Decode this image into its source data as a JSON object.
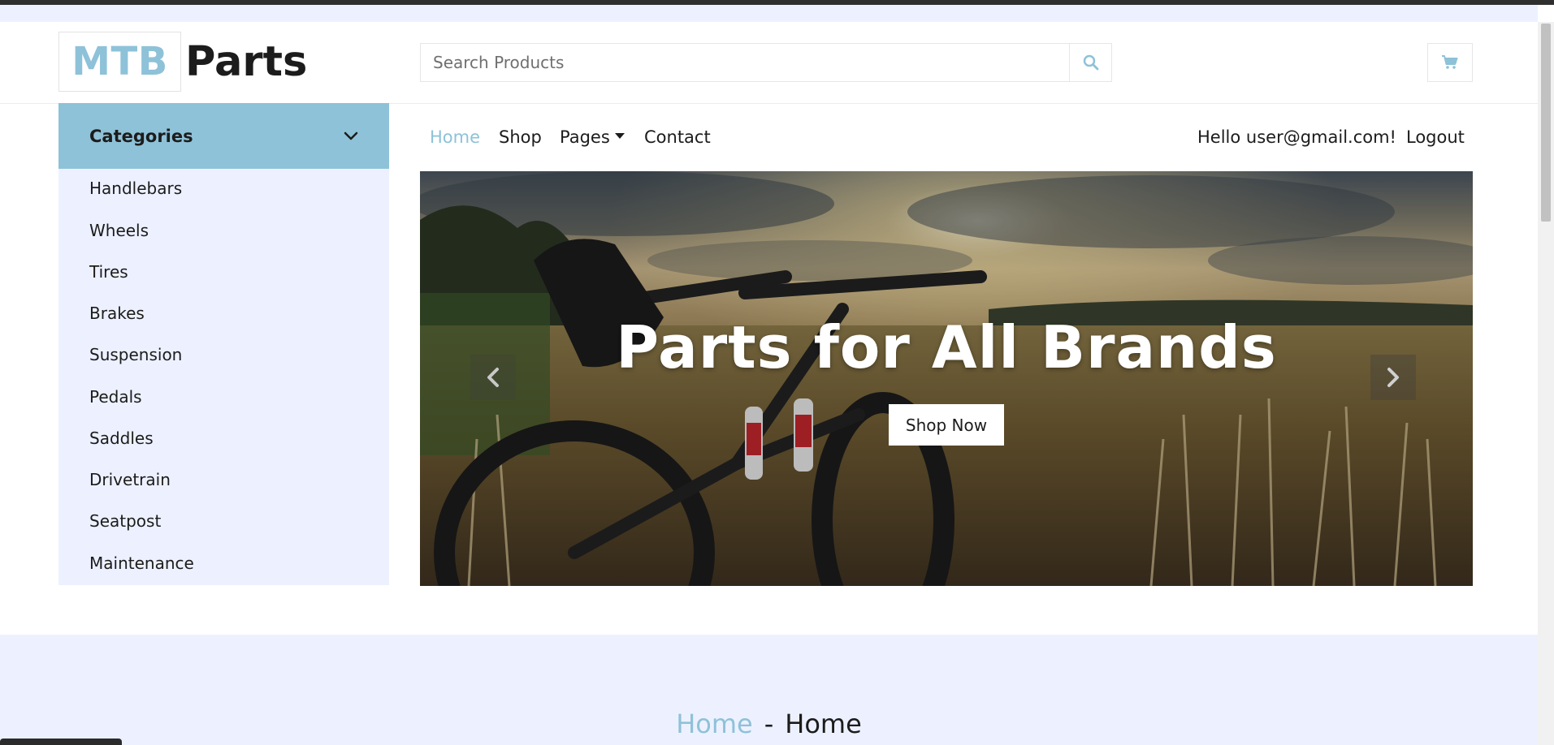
{
  "header": {
    "logo_primary": "MTB",
    "logo_secondary": "Parts",
    "search": {
      "placeholder": "Search Products",
      "value": ""
    },
    "search_icon": "search-icon",
    "cart_icon": "shopping-cart-icon"
  },
  "sidebar": {
    "title": "Categories",
    "toggle_icon": "chevron-down-icon",
    "items": [
      {
        "label": "Handlebars"
      },
      {
        "label": "Wheels"
      },
      {
        "label": "Tires"
      },
      {
        "label": "Brakes"
      },
      {
        "label": "Suspension"
      },
      {
        "label": "Pedals"
      },
      {
        "label": "Saddles"
      },
      {
        "label": "Drivetrain"
      },
      {
        "label": "Seatpost"
      },
      {
        "label": "Maintenance"
      }
    ]
  },
  "nav": {
    "links": [
      {
        "label": "Home",
        "active": true
      },
      {
        "label": "Shop"
      },
      {
        "label": "Pages",
        "has_dropdown": true
      },
      {
        "label": "Contact"
      }
    ],
    "greeting": "Hello user@gmail.com!",
    "logout": "Logout"
  },
  "hero": {
    "title": "Parts for All Brands",
    "button": "Shop Now",
    "prev_icon": "chevron-left-icon",
    "next_icon": "chevron-right-icon"
  },
  "breadcrumb": {
    "link": "Home",
    "separator": "-",
    "current": "Home"
  },
  "colors": {
    "accent": "#8ec2d8",
    "light_bg": "#edf1ff",
    "text": "#1c1c1c"
  }
}
